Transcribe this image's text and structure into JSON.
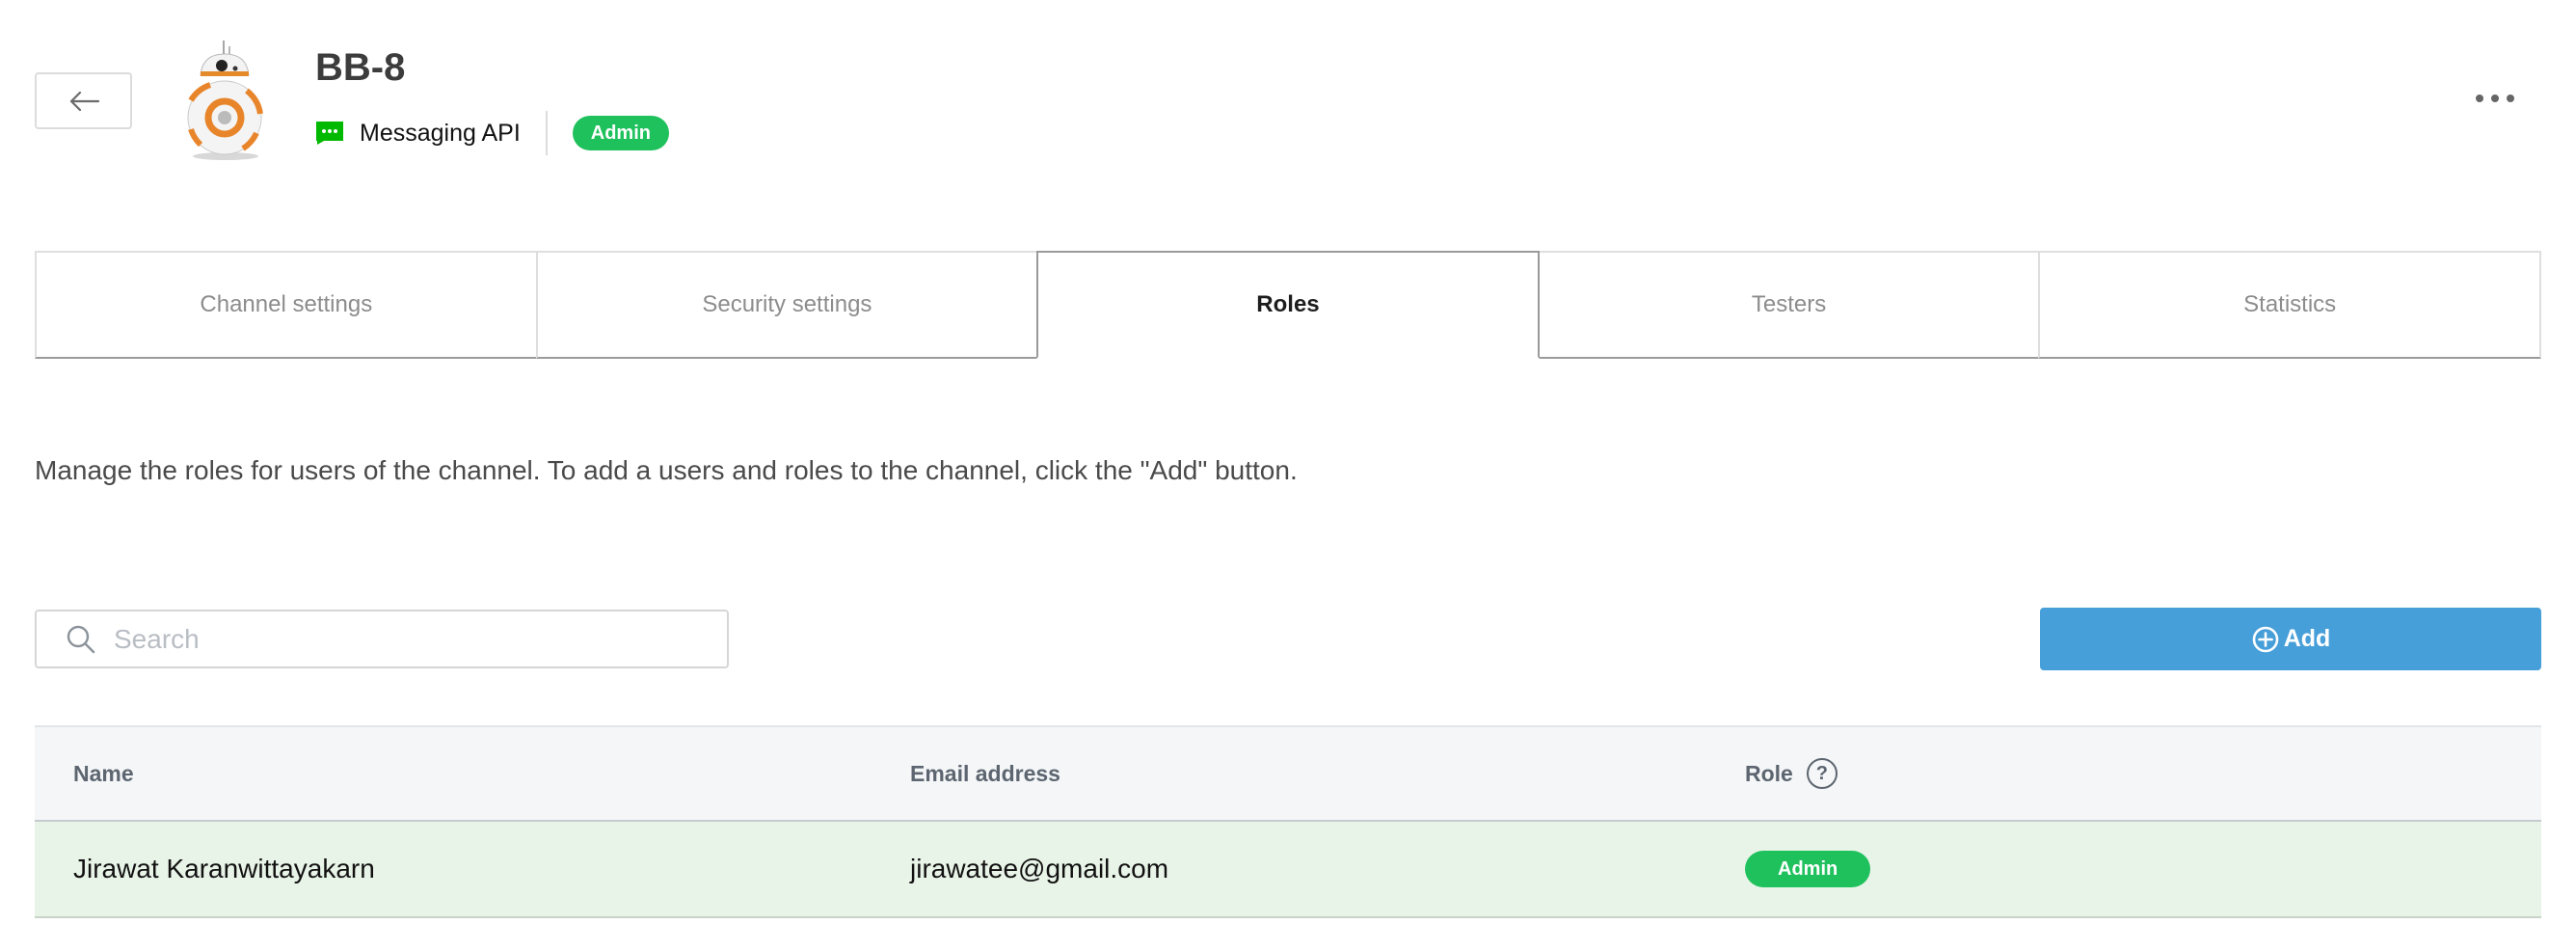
{
  "header": {
    "title": "BB-8",
    "channel_type": "Messaging API",
    "role_badge": "Admin",
    "back_icon": "arrow-left-icon",
    "more_icon": "more-horizontal-icon"
  },
  "tabs": [
    {
      "label": "Channel settings",
      "active": false
    },
    {
      "label": "Security settings",
      "active": false
    },
    {
      "label": "Roles",
      "active": true
    },
    {
      "label": "Testers",
      "active": false
    },
    {
      "label": "Statistics",
      "active": false
    }
  ],
  "description": "Manage the roles for users of the channel. To add a users and roles to the channel, click the \"Add\" button.",
  "search": {
    "placeholder": "Search",
    "value": ""
  },
  "add_button": {
    "label": "Add",
    "icon": "plus-circle-icon"
  },
  "table": {
    "headers": {
      "name": "Name",
      "email": "Email address",
      "role": "Role",
      "role_help": "?"
    },
    "rows": [
      {
        "name": "Jirawat Karanwittayakarn",
        "email": "jirawatee@gmail.com",
        "role": "Admin"
      }
    ]
  },
  "colors": {
    "accent_blue": "#479fd9",
    "badge_green": "#1fc15d",
    "row_highlight": "#e9f4e8",
    "messaging_icon_green": "#00b900"
  }
}
